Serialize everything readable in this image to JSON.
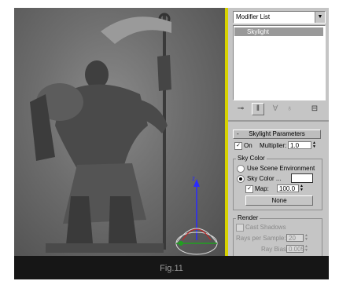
{
  "caption": "Fig.11",
  "viewport": {
    "gizmo_axis_label": "z"
  },
  "panel": {
    "modifier_list": "Modifier List",
    "stack_item": "Skylight",
    "rollout_toggle": "-",
    "rollout_title": "Skylight Parameters",
    "on_label": "On",
    "on_checked": true,
    "multiplier_label": "Multiplier:",
    "multiplier_value": "1.0",
    "sky_color_group": "Sky Color",
    "use_scene_env_label": "Use Scene Environment",
    "sky_color_label": "Sky Color ...",
    "sky_color_swatch": "#ffffff",
    "map_label": "Map:",
    "map_checked": true,
    "map_value": "100.0",
    "map_button": "None",
    "render_group": "Render",
    "cast_shadows_label": "Cast Shadows",
    "rays_label": "Rays per Sample:",
    "rays_value": "20",
    "ray_bias_label": "Ray Bias:",
    "ray_bias_value": "0.005"
  },
  "colors": {
    "gold_border": "#d7d200",
    "panel_bg": "#c5c5c5",
    "frame_bg": "#161616"
  }
}
